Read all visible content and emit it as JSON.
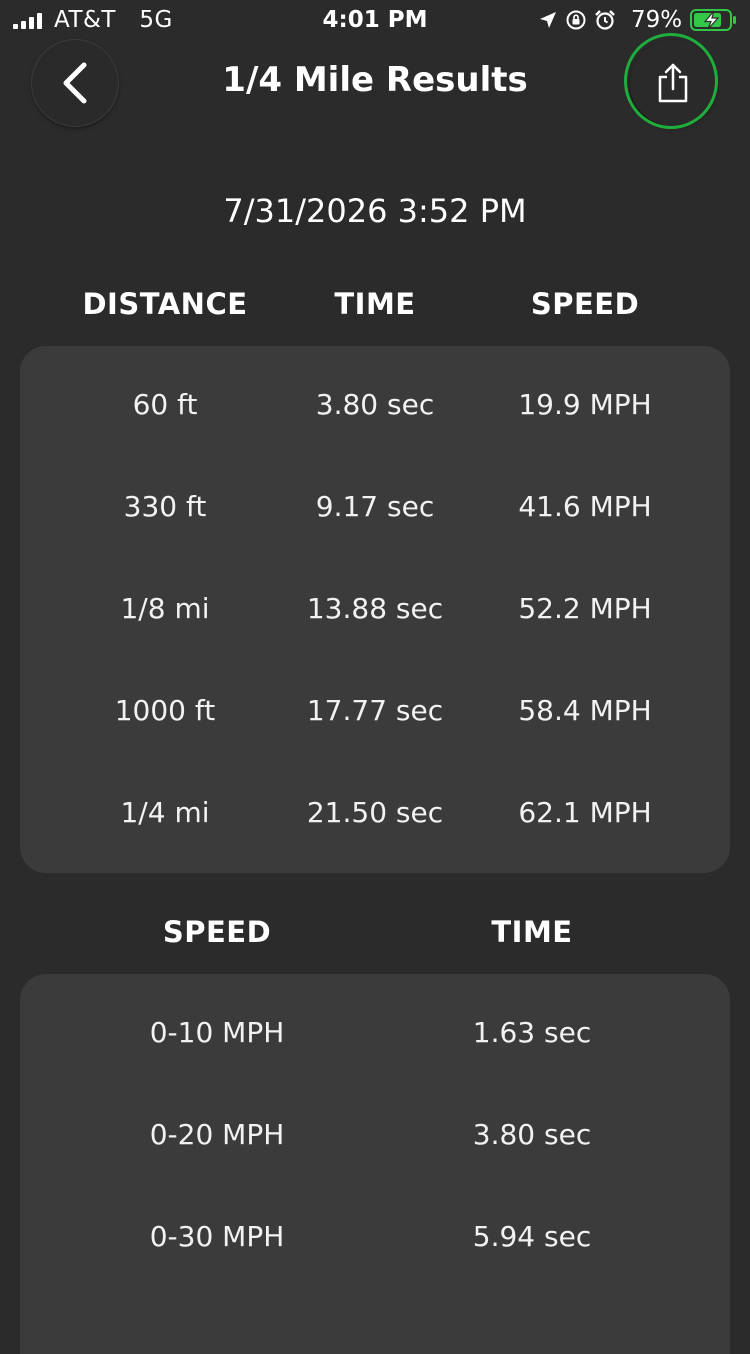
{
  "status_bar": {
    "carrier": "AT&T   5G",
    "time": "4:01 PM",
    "battery_percent": "79%",
    "icons": [
      "signal-bars-icon",
      "location-arrow-icon",
      "orientation-lock-icon",
      "alarm-icon",
      "battery-charging-icon"
    ]
  },
  "header": {
    "title": "1/4 Mile Results",
    "back_icon": "chevron-left-icon",
    "share_icon": "share-icon"
  },
  "run": {
    "date": "7/31/2026 3:52 PM"
  },
  "distance_table": {
    "headers": [
      "DISTANCE",
      "TIME",
      "SPEED"
    ],
    "rows": [
      [
        "60 ft",
        "3.80 sec",
        "19.9 MPH"
      ],
      [
        "330 ft",
        "9.17 sec",
        "41.6 MPH"
      ],
      [
        "1/8 mi",
        "13.88 sec",
        "52.2 MPH"
      ],
      [
        "1000 ft",
        "17.77 sec",
        "58.4 MPH"
      ],
      [
        "1/4 mi",
        "21.50 sec",
        "62.1 MPH"
      ]
    ]
  },
  "speed_table": {
    "headers": [
      "SPEED",
      "TIME"
    ],
    "rows": [
      [
        "0-10 MPH",
        "1.63 sec"
      ],
      [
        "0-20 MPH",
        "3.80 sec"
      ],
      [
        "0-30 MPH",
        "5.94 sec"
      ]
    ]
  },
  "colors": {
    "background": "#2b2b2b",
    "panel": "#3b3b3b",
    "highlight_ring": "#1fad3c",
    "battery_fill": "#33c748"
  }
}
